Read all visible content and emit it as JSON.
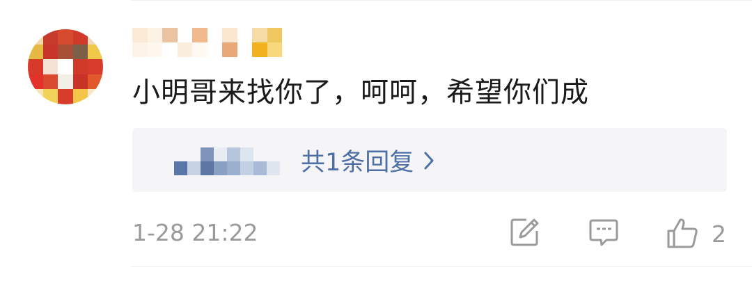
{
  "comment": {
    "text": "小明哥来找你了，呵呵，希望你们成",
    "timestamp": "1-28 21:22",
    "like_count": "2"
  },
  "reply": {
    "summary": "共1条回复"
  },
  "icons": {
    "repost": "edit-share-icon",
    "comment": "comment-bubble-icon",
    "like": "thumbs-up-icon",
    "reply_arrow": "chevron-right-icon"
  },
  "colors": {
    "text_primary": "#1a1a1a",
    "text_secondary": "#9a9a9a",
    "link": "#4e6fa5",
    "reply_bg": "#f5f5f7"
  }
}
